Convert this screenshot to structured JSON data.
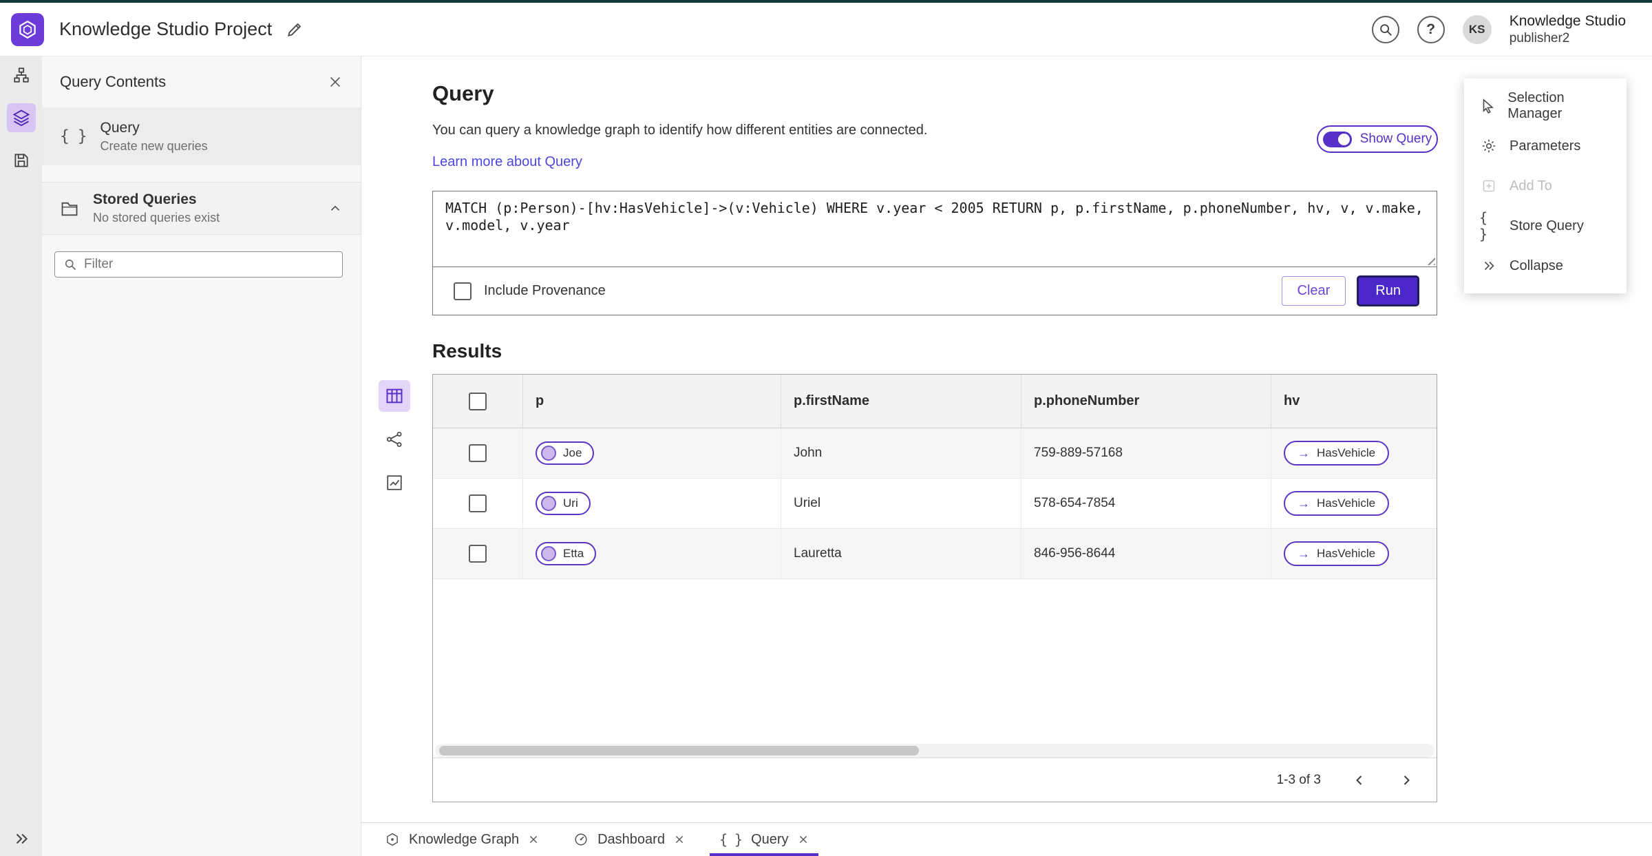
{
  "header": {
    "title": "Knowledge Studio Project",
    "help_label": "?",
    "avatar_initials": "KS",
    "user_name": "Knowledge Studio",
    "user_role": "publisher2"
  },
  "sidebar": {
    "title": "Query Contents",
    "query_item_title": "Query",
    "query_item_subtitle": "Create new queries",
    "stored_title": "Stored Queries",
    "stored_subtitle": "No stored queries exist",
    "filter_placeholder": "Filter"
  },
  "query": {
    "heading": "Query",
    "description": "You can query a knowledge graph to identify how different entities are connected.",
    "learn_more": "Learn more about Query",
    "show_query": "Show Query",
    "text_line": "MATCH (p:Person)-[hv:HasVehicle]->(v:Vehicle) WHERE v.year < 2005 RETURN p, p.firstName, p.phoneNumber, hv, v, v.make, v.model, v.year",
    "include_provenance": "Include Provenance",
    "clear": "Clear",
    "run": "Run"
  },
  "results": {
    "heading": "Results",
    "columns": [
      "p",
      "p.firstName",
      "p.phoneNumber",
      "hv"
    ],
    "rows": [
      {
        "p": "Joe",
        "firstName": "John",
        "phone": "759-889-57168",
        "hv": "HasVehicle"
      },
      {
        "p": "Uri",
        "firstName": "Uriel",
        "phone": "578-654-7854",
        "hv": "HasVehicle"
      },
      {
        "p": "Etta",
        "firstName": "Lauretta",
        "phone": "846-956-8644",
        "hv": "HasVehicle"
      }
    ],
    "arrow": "→",
    "pagination": "1-3 of 3"
  },
  "context_menu": {
    "selection_manager": "Selection Manager",
    "parameters": "Parameters",
    "add_to": "Add To",
    "store_query": "Store Query",
    "collapse": "Collapse"
  },
  "tabs": [
    {
      "label": "Knowledge Graph"
    },
    {
      "label": "Dashboard"
    },
    {
      "label": "Query"
    }
  ],
  "icons": {
    "braces": "{ }"
  },
  "colors": {
    "accent": "#5630c8",
    "run_button": "#4c28cb",
    "accent_light": "#d7c5f4",
    "link": "#4b47dd",
    "top_strip": "#12383e"
  }
}
